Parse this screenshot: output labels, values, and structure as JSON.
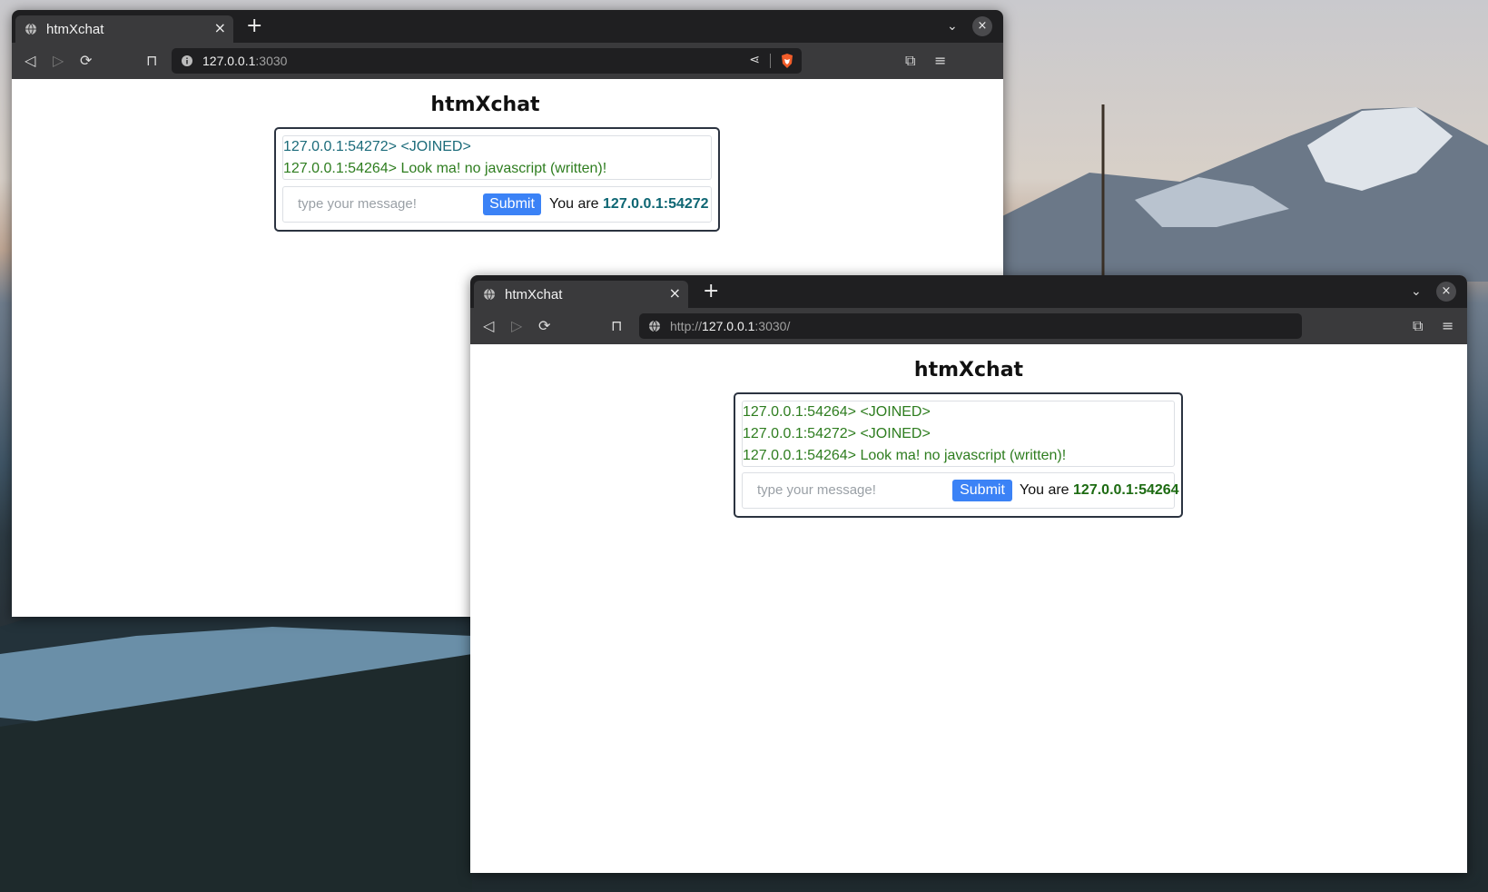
{
  "colors": {
    "joined_teal": "#1b6b7a",
    "message_green": "#2e7d1f",
    "self_id_teal": "#0e6673",
    "self_id_green": "#1d6b12",
    "submit_blue": "#3b82f6"
  },
  "window_back": {
    "tab": {
      "title": "htmXchat",
      "close": "×"
    },
    "new_tab": "+",
    "tab_menu": "⌄",
    "window_close": "×",
    "url": {
      "host": "127.0.0.1",
      "rest": ":3030"
    },
    "page": {
      "heading": "htmXchat",
      "messages": [
        {
          "text": "127.0.0.1:54272> <JOINED>",
          "kind": "joined"
        },
        {
          "text": "127.0.0.1:54264> Look ma! no javascript (written)!",
          "kind": "message"
        }
      ],
      "input_placeholder": "type your message!",
      "submit_label": "Submit",
      "you_are_label": "You are",
      "self_id": "127.0.0.1:54272"
    }
  },
  "window_front": {
    "tab": {
      "title": "htmXchat",
      "close": "×"
    },
    "new_tab": "+",
    "tab_menu": "⌄",
    "window_close": "×",
    "url": {
      "scheme": "http://",
      "host": "127.0.0.1",
      "rest": ":3030/"
    },
    "page": {
      "heading": "htmXchat",
      "messages": [
        {
          "text": "127.0.0.1:54264> <JOINED>",
          "kind": "joined"
        },
        {
          "text": "127.0.0.1:54272> <JOINED>",
          "kind": "joined"
        },
        {
          "text": "127.0.0.1:54264> Look ma! no javascript (written)!",
          "kind": "message"
        }
      ],
      "input_placeholder": "type your message!",
      "submit_label": "Submit",
      "you_are_label": "You are",
      "self_id": "127.0.0.1:54264"
    }
  }
}
